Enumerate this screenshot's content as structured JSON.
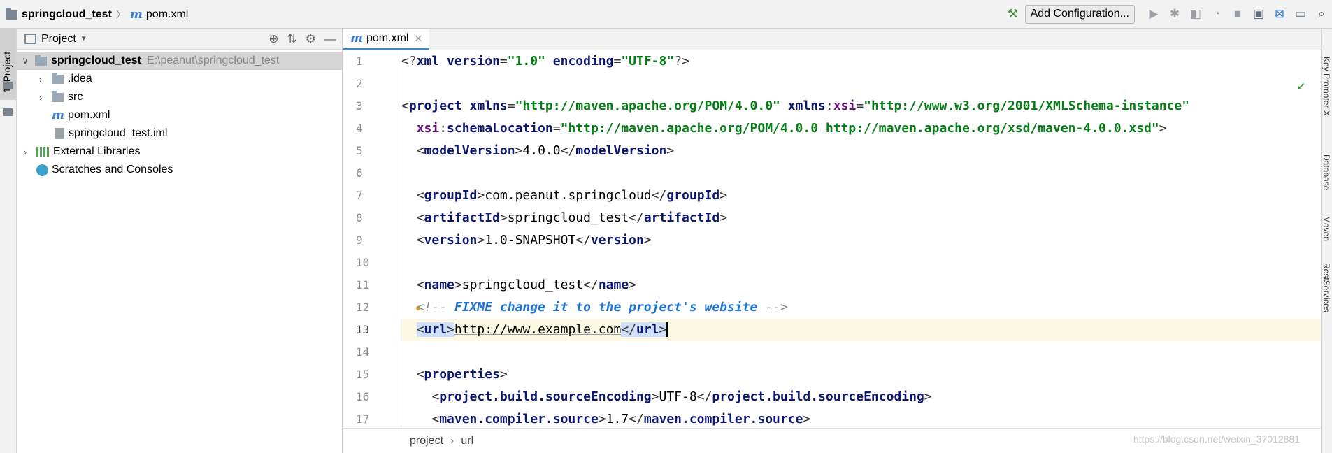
{
  "breadcrumb": {
    "project": "springcloud_test",
    "file": "pom.xml"
  },
  "toolbar": {
    "add_configuration": "Add Configuration..."
  },
  "left_strip": {
    "project_tab": "1: Project"
  },
  "project_panel": {
    "title": "Project",
    "items": [
      {
        "name": "springcloud_test",
        "path": "E:\\peanut\\springcloud_test"
      },
      {
        "name": ".idea"
      },
      {
        "name": "src"
      },
      {
        "name": "pom.xml"
      },
      {
        "name": "springcloud_test.iml"
      },
      {
        "name": "External Libraries"
      },
      {
        "name": "Scratches and Consoles"
      }
    ]
  },
  "editor": {
    "tab": "pom.xml",
    "line_numbers": [
      "1",
      "2",
      "3",
      "4",
      "5",
      "6",
      "7",
      "8",
      "9",
      "10",
      "11",
      "12",
      "13",
      "14",
      "15",
      "16",
      "17"
    ],
    "status_crumbs": [
      "project",
      "url"
    ]
  },
  "right_strip": {
    "tabs": [
      "Key Promoter X",
      "Database",
      "Maven",
      "RestServices"
    ]
  },
  "watermark": "https://blog.csdn.net/weixin_37012881"
}
